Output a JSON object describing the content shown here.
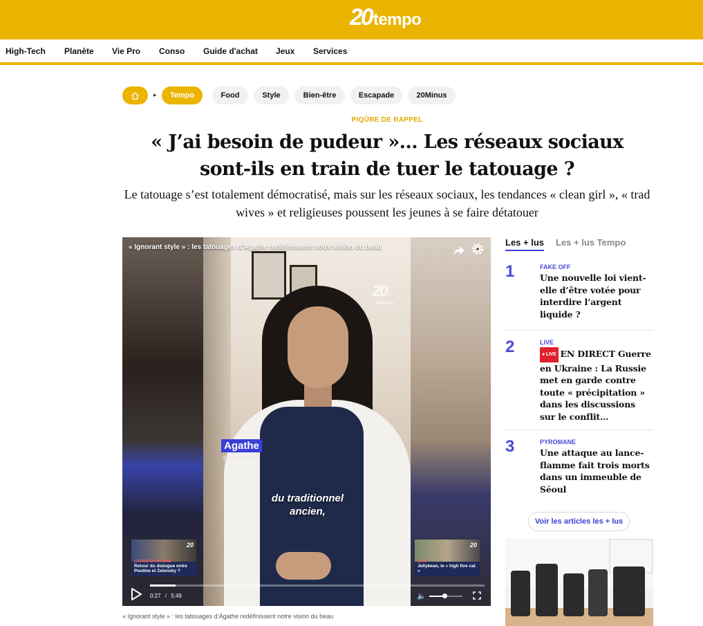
{
  "header": {
    "logo_number": "20",
    "logo_word": "tempo",
    "brand_color": "#ebb400"
  },
  "nav": {
    "items": [
      "High-Tech",
      "Planète",
      "Vie Pro",
      "Conso",
      "Guide d'achat",
      "Jeux",
      "Services"
    ]
  },
  "breadcrumb": {
    "home_icon": "home-icon",
    "separator": "▸",
    "current": "Tempo",
    "tags": [
      "Food",
      "Style",
      "Bien-être",
      "Escapade",
      "20Minus"
    ]
  },
  "article": {
    "kicker": "PIQÛRE DE RAPPEL",
    "headline": "« J’ai besoin de pudeur »… Les réseaux sociaux sont-ils en train de tuer le tatouage ?",
    "dek": "Le tatouage s’est totalement démocratisé, mais sur les réseaux sociaux, les tendances « clean girl », « trad wives » et religieuses poussent les jeunes à se faire détatouer",
    "caption": "« Ignorant style » : les tatouages d’Agathe redéfinissent notre vision du beau"
  },
  "video": {
    "title": "« Ignorant style » : les tatouages d’Agathe redéfinissent notre vision du beau",
    "watermark": "20",
    "watermark_sub": "Minutes",
    "speaker_name": "Agathe",
    "speaker_role": "TATOUEUSE",
    "subtitle": "du traditionnel ancien,",
    "current_time": "0:27",
    "time_separator": "/",
    "duration": "5:49",
    "progress": 0.077,
    "volume": 0.45,
    "thumb_left": {
      "tag": "GUERRE EN UKRAINE",
      "text": "Retour du dialogue entre Poutine et Zelensky ?",
      "logo": "20"
    },
    "thumb_right": {
      "tag": "CHAT",
      "text": "Jellybean, le « high five cat »",
      "logo": "20"
    },
    "icons": {
      "share": "share-icon",
      "settings": "gear-icon",
      "play": "play-icon",
      "volume": "volume-icon",
      "fullscreen": "fullscreen-icon"
    }
  },
  "sidebar": {
    "tabs": [
      "Les + lus",
      "Les + lus Tempo"
    ],
    "items": [
      {
        "rank": "1",
        "tag": "FAKE OFF",
        "live": "",
        "title": "Une nouvelle loi vient-elle d’être votée pour interdire l’argent liquide ?"
      },
      {
        "rank": "2",
        "tag": "LIVE",
        "live": "● LIVE",
        "title": "EN DIRECT Guerre en Ukraine : La Russie met en garde contre toute « précipitation » dans les discussions sur le conflit…"
      },
      {
        "rank": "3",
        "tag": "PYROMANE",
        "live": "",
        "title": "Une attaque au lance-flamme fait trois morts dans un immeuble de Séoul"
      }
    ],
    "more_button": "Voir les articles les + lus",
    "accent_color": "#4a4ad9"
  }
}
